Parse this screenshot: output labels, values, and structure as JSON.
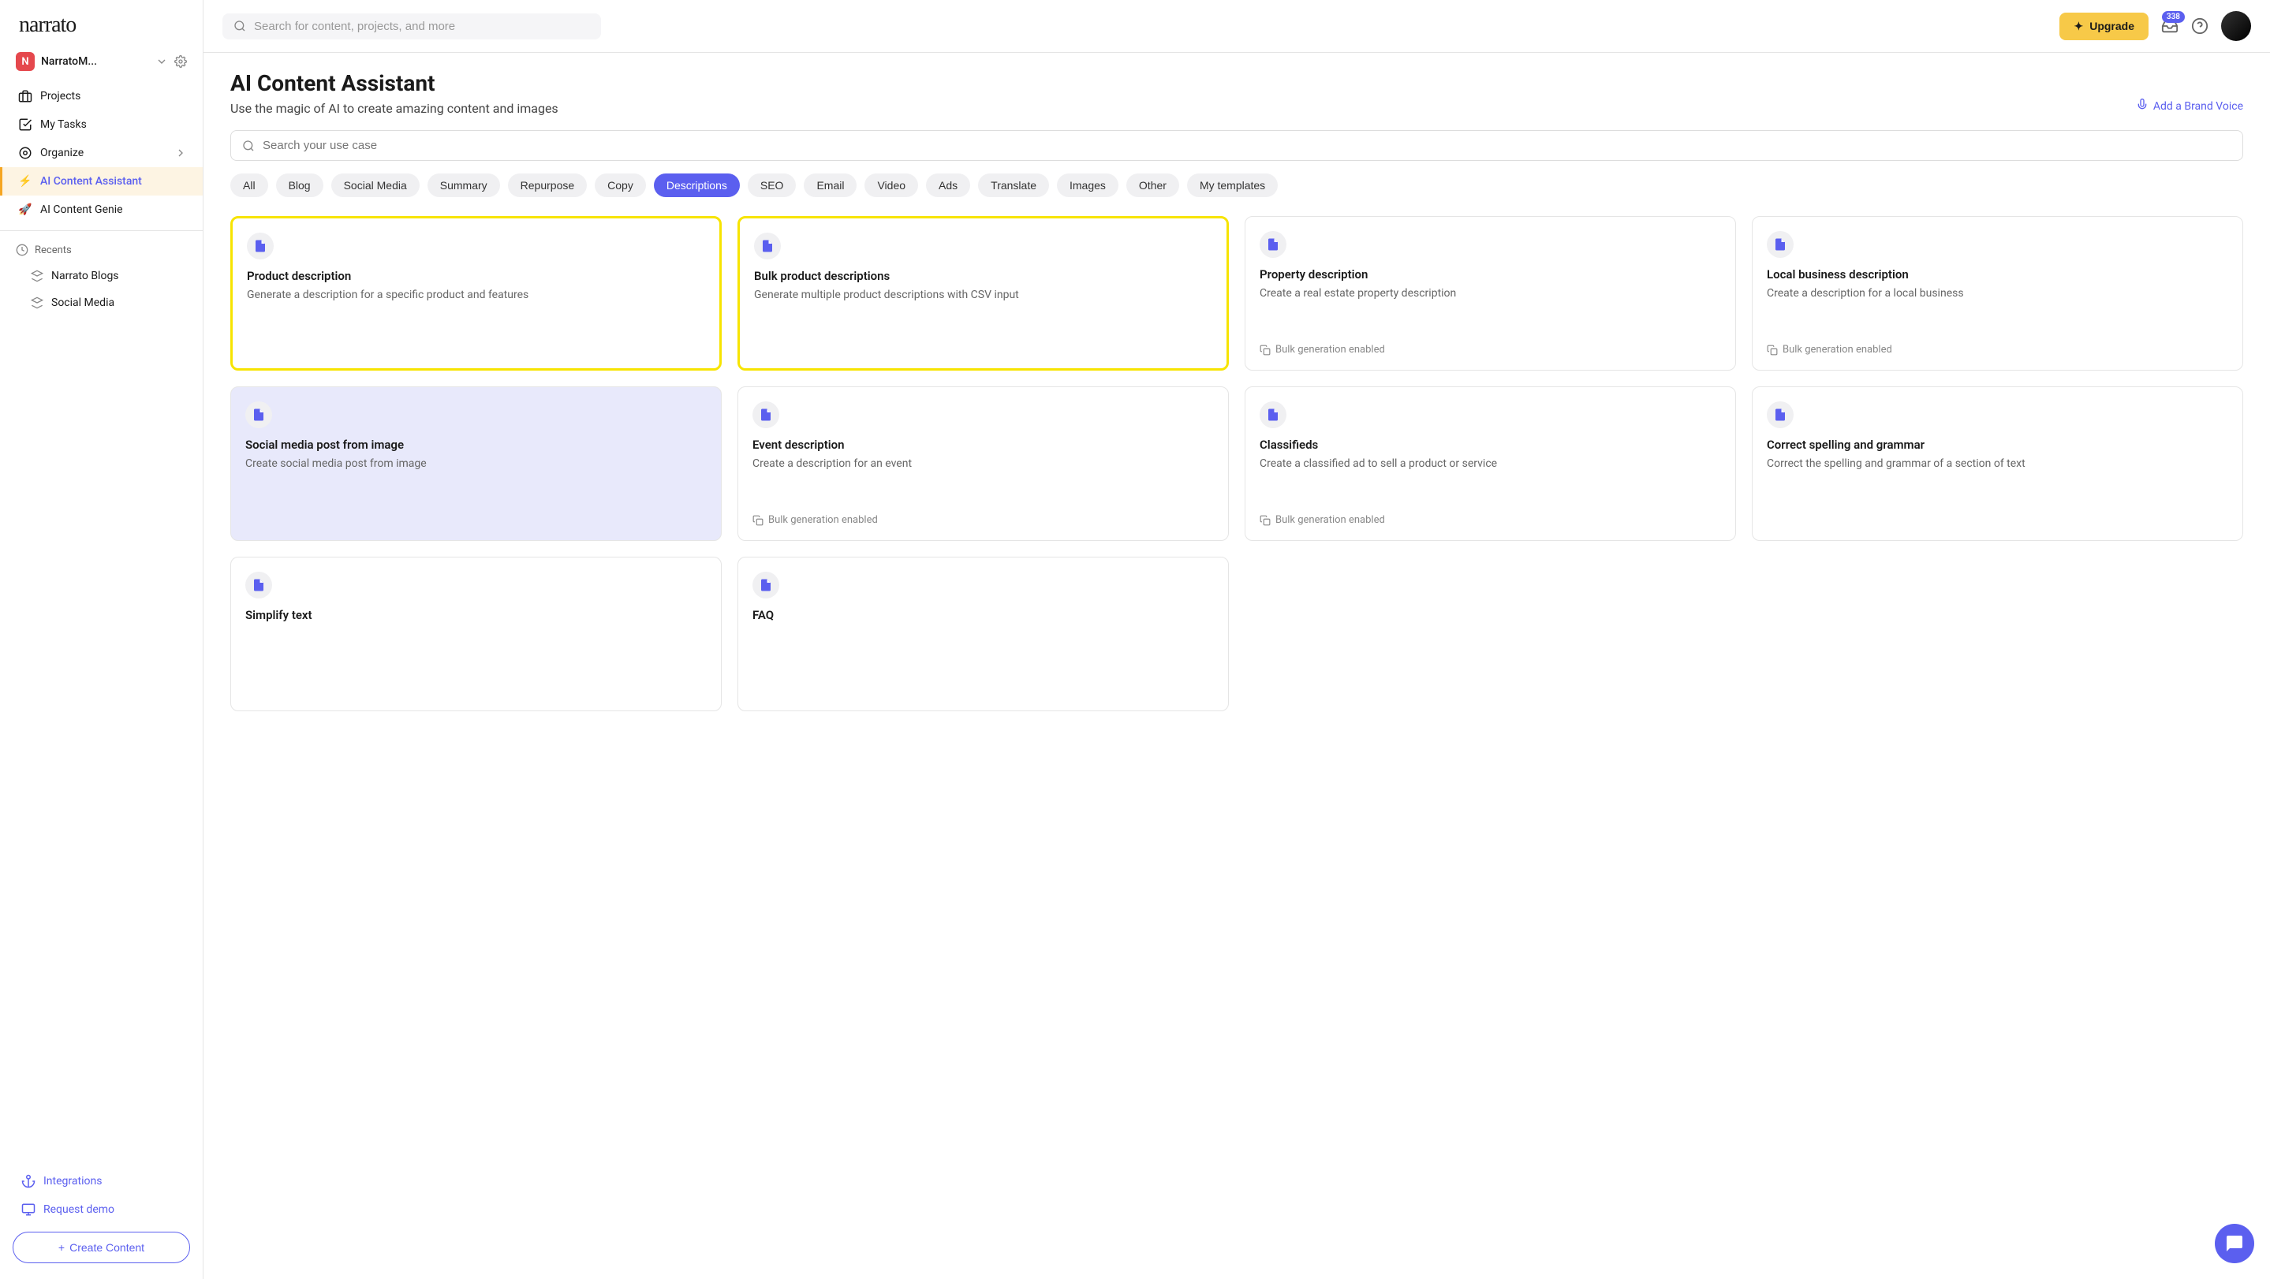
{
  "logo": "narrato",
  "workspace": {
    "initial": "N",
    "name": "NarratoM..."
  },
  "nav": {
    "projects": "Projects",
    "my_tasks": "My Tasks",
    "organize": "Organize",
    "ai_assistant": "AI Content Assistant",
    "ai_genie": "AI Content Genie",
    "recents": "Recents",
    "recent_items": [
      "Narrato Blogs",
      "Social Media"
    ],
    "integrations": "Integrations",
    "request_demo": "Request demo",
    "create_content": "Create Content"
  },
  "topbar": {
    "search_placeholder": "Search for content, projects, and more",
    "upgrade": "Upgrade",
    "notif_count": "338"
  },
  "page": {
    "title": "AI Content Assistant",
    "subtitle": "Use the magic of AI to create amazing content and images",
    "brand_voice": "Add a Brand Voice",
    "usecase_placeholder": "Search your use case"
  },
  "filters": [
    "All",
    "Blog",
    "Social Media",
    "Summary",
    "Repurpose",
    "Copy",
    "Descriptions",
    "SEO",
    "Email",
    "Video",
    "Ads",
    "Translate",
    "Images",
    "Other",
    "My templates"
  ],
  "filter_active_index": 6,
  "bulk_label": "Bulk generation enabled",
  "cards": [
    {
      "title": "Product description",
      "desc": "Generate a description for a specific product and features",
      "bulk": false
    },
    {
      "title": "Bulk product descriptions",
      "desc": "Generate multiple product descriptions with CSV input",
      "bulk": false
    },
    {
      "title": "Property description",
      "desc": "Create a real estate property description",
      "bulk": true
    },
    {
      "title": "Local business description",
      "desc": "Create a description for a local business",
      "bulk": true
    },
    {
      "title": "Social media post from image",
      "desc": "Create social media post from image",
      "bulk": false
    },
    {
      "title": "Event description",
      "desc": "Create a description for an event",
      "bulk": true
    },
    {
      "title": "Classifieds",
      "desc": "Create a classified ad to sell a product or service",
      "bulk": true
    },
    {
      "title": "Correct spelling and grammar",
      "desc": "Correct the spelling and grammar of a section of text",
      "bulk": false
    },
    {
      "title": "Simplify text",
      "desc": "",
      "bulk": false
    },
    {
      "title": "FAQ",
      "desc": "",
      "bulk": false
    }
  ]
}
